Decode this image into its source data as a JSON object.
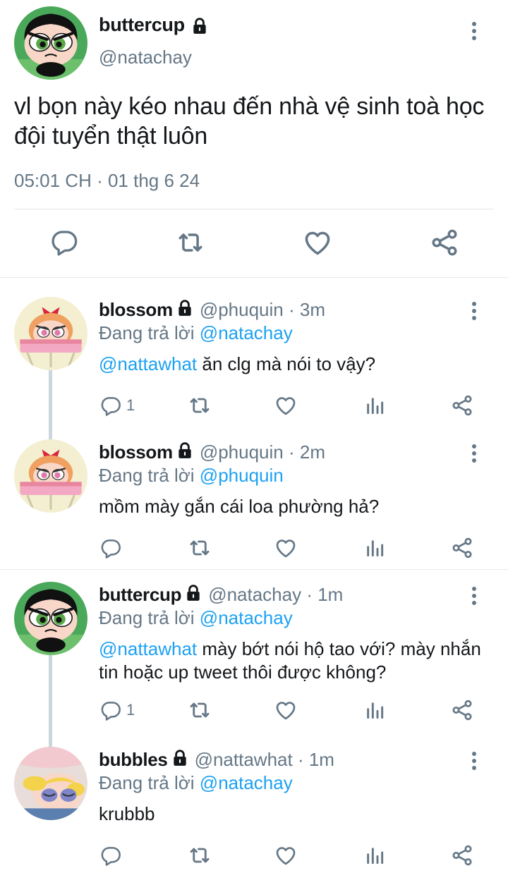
{
  "main_tweet": {
    "name": "buttercup",
    "handle": "@natachay",
    "text": "vl bọn này kéo nhau đến nhà vệ sinh toà học đội tuyển thật luôn",
    "timestamp": "05:01 CH · 01 thg 6 24"
  },
  "replies": [
    {
      "name": "blossom",
      "handle": "@phuquin",
      "time": "· 3m",
      "replying_prefix": "Đang trả lời",
      "replying_to": "@natachay",
      "mention": "@nattawhat",
      "text": " ăn clg mà nói to vậy?",
      "reply_count": "1"
    },
    {
      "name": "blossom",
      "handle": "@phuquin",
      "time": "· 2m",
      "replying_prefix": "Đang trả lời",
      "replying_to": "@phuquin",
      "mention": "",
      "text": "mồm mày gắn cái loa phường hả?",
      "reply_count": ""
    },
    {
      "name": "buttercup",
      "handle": "@natachay",
      "time": "· 1m",
      "replying_prefix": "Đang trả lời",
      "replying_to": "@natachay",
      "mention": "@nattawhat",
      "text": " mày bớt nói hộ tao với? mày nhắn tin hoặc up tweet thôi được không?",
      "reply_count": "1"
    },
    {
      "name": "bubbles",
      "handle": "@nattawhat",
      "time": "· 1m",
      "replying_prefix": "Đang trả lời",
      "replying_to": "@natachay",
      "mention": "",
      "text": "krubbb",
      "reply_count": ""
    }
  ],
  "colors": {
    "link": "#1da1f2",
    "muted": "#657786",
    "text": "#14171a",
    "buttercup_bg": "#4aa85a",
    "blossom_bg": "#f3efd0",
    "bubbles_bg": "#e8ddd8"
  },
  "icons": [
    "lock-icon",
    "more-icon",
    "reply-icon",
    "retweet-icon",
    "like-icon",
    "share-icon",
    "analytics-icon"
  ]
}
